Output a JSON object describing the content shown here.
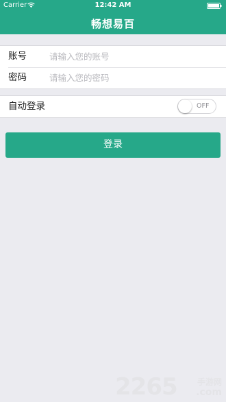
{
  "status_bar": {
    "carrier": "Carrier",
    "time": "12:42 AM",
    "wifi_icon": "wifi-icon",
    "battery_icon": "battery-icon"
  },
  "header": {
    "title": "畅想易百"
  },
  "login_form": {
    "account_label": "账号",
    "account_placeholder": "请输入您的账号",
    "password_label": "密码",
    "password_placeholder": "请输入您的密码"
  },
  "auto_login": {
    "label": "自动登录",
    "toggle_state": "OFF"
  },
  "login_button": {
    "label": "登录"
  },
  "watermark": {
    "number": "2265",
    "label": "手游网",
    "domain": ".com"
  },
  "colors": {
    "brand": "#26a889",
    "background": "#ebebf0"
  }
}
